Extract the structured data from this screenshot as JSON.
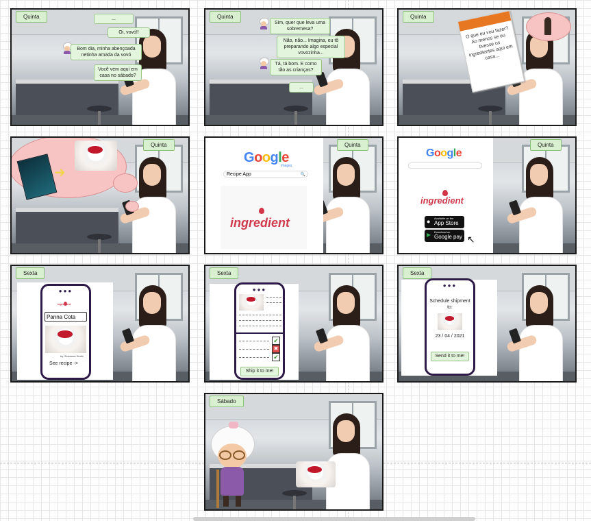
{
  "frames": [
    {
      "tag": "Quinta",
      "bubbles": [
        "...",
        "Oi, vovó!!",
        "Bom dia, minha abençoada netinha amada da vovó",
        "Você vem aqui em casa no sábado?"
      ]
    },
    {
      "tag": "Quinta",
      "bubbles": [
        "Sim, quer que leva uma sobremesa?",
        "Não, não... Imagina, eu tô preparando algo especial vovozinha...",
        "Tá, tá bom. E como tão as crianças?",
        "..."
      ]
    },
    {
      "tag": "Quinta",
      "note": "O que eu vou fazer? Ao menos se eu tivesse os ingredientes aqui em casa..."
    },
    {
      "tag": "Quinta"
    },
    {
      "tag": "Quinta",
      "search_value": "Recipe App",
      "google": "Google",
      "google_sub": "Images",
      "brand": "ingredient"
    },
    {
      "tag": "Quinta",
      "google": "Google",
      "brand": "ingredient",
      "appstore_small": "Available on the",
      "appstore": "App Store",
      "googleplay_small": "Download on",
      "googleplay": "Google pay"
    },
    {
      "tag": "Sexta",
      "brand_small": "ingredient",
      "search_value": "Panna Cota",
      "author": "by Giovanna Smith",
      "see_recipe": "See recipe ->"
    },
    {
      "tag": "Sexta",
      "ship_button": "Ship it to me!"
    },
    {
      "tag": "Sexta",
      "schedule_title": "Schedule shipment to:",
      "date": "23 / 04 / 2021",
      "send_button": "Send it to me!"
    },
    {
      "tag": "Sábado"
    }
  ],
  "colors": {
    "tag_bg": "#d9f0d0",
    "tag_border": "#8bbf7a",
    "phone_frame": "#2e1a47",
    "brand": "#cf3a4c",
    "note_header": "#e87722"
  }
}
